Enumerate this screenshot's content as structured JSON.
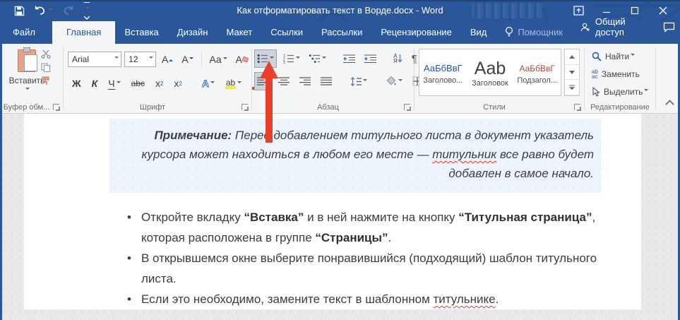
{
  "titlebar": {
    "title": "Как отформатировать текст в Ворде.docx - Word"
  },
  "tabs": [
    {
      "label": "Файл"
    },
    {
      "label": "Главная",
      "active": true
    },
    {
      "label": "Вставка"
    },
    {
      "label": "Дизайн"
    },
    {
      "label": "Макет"
    },
    {
      "label": "Ссылки"
    },
    {
      "label": "Рассылки"
    },
    {
      "label": "Рецензирование"
    },
    {
      "label": "Вид"
    }
  ],
  "assistant": {
    "label": "Помощник"
  },
  "share": {
    "label": "Общий доступ"
  },
  "ribbon": {
    "clipboard": {
      "paste": "Вставить",
      "label": "Буфер обм..."
    },
    "font": {
      "family": "Arial",
      "size": "12",
      "bold": "Ж",
      "italic": "К",
      "underline": "Ч",
      "strike": "abc",
      "subscript": "x",
      "superscript": "x",
      "case": "Aa",
      "grow": "A",
      "shrink": "A",
      "effects": "А",
      "highlight": "ab",
      "color": "А",
      "clear": "А",
      "label": "Шрифт"
    },
    "paragraph": {
      "sort_top": "А",
      "sort_bottom": "Я",
      "pilcrow": "¶",
      "label": "Абзац"
    },
    "styles": {
      "label": "Стили",
      "items": [
        {
          "preview": "АаБбВвГ",
          "name": "Заголово..."
        },
        {
          "preview": "Aab",
          "name": "Заголовок"
        },
        {
          "preview": "АаБбВвГ",
          "name": "Подзагол..."
        }
      ]
    },
    "editing": {
      "find": "Найти",
      "replace": "Заменить",
      "select": "Выделить",
      "label": "Редактирование"
    }
  },
  "document": {
    "note": {
      "lead": "Примечание:",
      "t1": " Перед добавлением титульного листа в документ указатель курсора может находиться в любом его месте — ",
      "misspelled": "титульник",
      "t2": " все равно будет добавлен в самое начало."
    },
    "bullets": [
      {
        "t1": "Откройте вкладку ",
        "b1": "“Вставка”",
        "t2": " и в ней нажмите на кнопку ",
        "b2": "“Титульная страница”",
        "t3": ", которая расположена в группе ",
        "b3": "“Страницы”",
        "t4": "."
      },
      {
        "t1": "В открывшемся окне выберите понравившийся (подходящий) шаблон титульного листа."
      },
      {
        "t1": "Если это необходимо, замените текст в шаблонном ",
        "misspelled": "титульнике",
        "t2": "."
      }
    ]
  },
  "colors": {
    "titlebar": "#2b579a",
    "ribbon_bg": "#f4f5f7",
    "arrow_red": "#e8402a",
    "note_bg": "#edf4fb",
    "highlight_yellow": "#ffe92c",
    "font_color_red": "#e0442f",
    "style_heading_blue": "#2b579a",
    "style_sub_red": "#b04a3e"
  }
}
